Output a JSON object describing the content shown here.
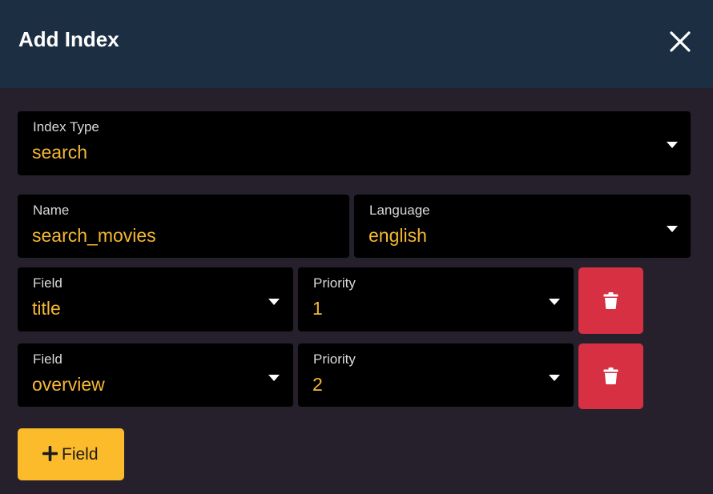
{
  "dialog": {
    "title": "Add Index",
    "close_icon": "close-icon"
  },
  "index_type": {
    "label": "Index Type",
    "value": "search"
  },
  "name": {
    "label": "Name",
    "value": "search_movies"
  },
  "language": {
    "label": "Language",
    "value": "english"
  },
  "fields": [
    {
      "field_label": "Field",
      "field_value": "title",
      "priority_label": "Priority",
      "priority_value": "1",
      "delete_icon": "trash-icon"
    },
    {
      "field_label": "Field",
      "field_value": "overview",
      "priority_label": "Priority",
      "priority_value": "2",
      "delete_icon": "trash-icon"
    }
  ],
  "add_field_button": {
    "label": "Field",
    "icon": "plus-icon"
  },
  "colors": {
    "header_bg": "#1c2f42",
    "body_bg": "#25202c",
    "input_bg": "#000000",
    "value_text": "#f5b833",
    "delete_button": "#d63042",
    "add_button": "#fbbb2b"
  }
}
